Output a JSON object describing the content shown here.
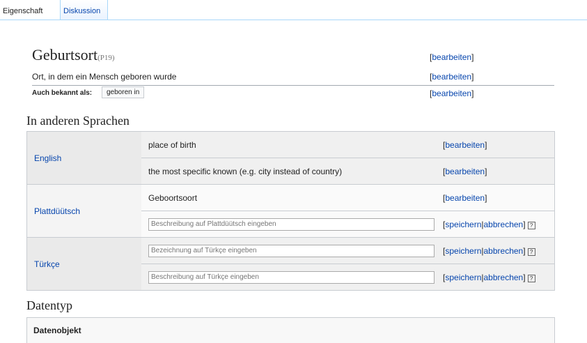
{
  "tabs": {
    "property": "Eigenschaft",
    "discussion": "Diskussion"
  },
  "entity": {
    "label": "Geburtsort",
    "id": "(P19)",
    "description": "Ort, in dem ein Mensch geboren wurde",
    "aliases_label": "Auch bekannt als:",
    "alias": "geboren in"
  },
  "edit": {
    "open": "[",
    "label": "bearbeiten",
    "close": "]"
  },
  "languages_heading": "In anderen Sprachen",
  "languages": [
    {
      "name": "English",
      "label": "place of birth",
      "description": "the most specific known (e.g. city instead of country)"
    },
    {
      "name": "Plattdüütsch",
      "label": "Geboortsoort",
      "description_placeholder": "Beschreibung auf Plattdüütsch eingeben"
    },
    {
      "name": "Türkçe",
      "label_placeholder": "Bezeichnung auf Türkçe eingeben",
      "description_placeholder": "Beschreibung auf Türkçe eingeben"
    }
  ],
  "actions": {
    "save": "speichern",
    "cancel": "abbrechen",
    "help": "?"
  },
  "datatype": {
    "heading": "Datentyp",
    "value": "Datenobjekt"
  }
}
